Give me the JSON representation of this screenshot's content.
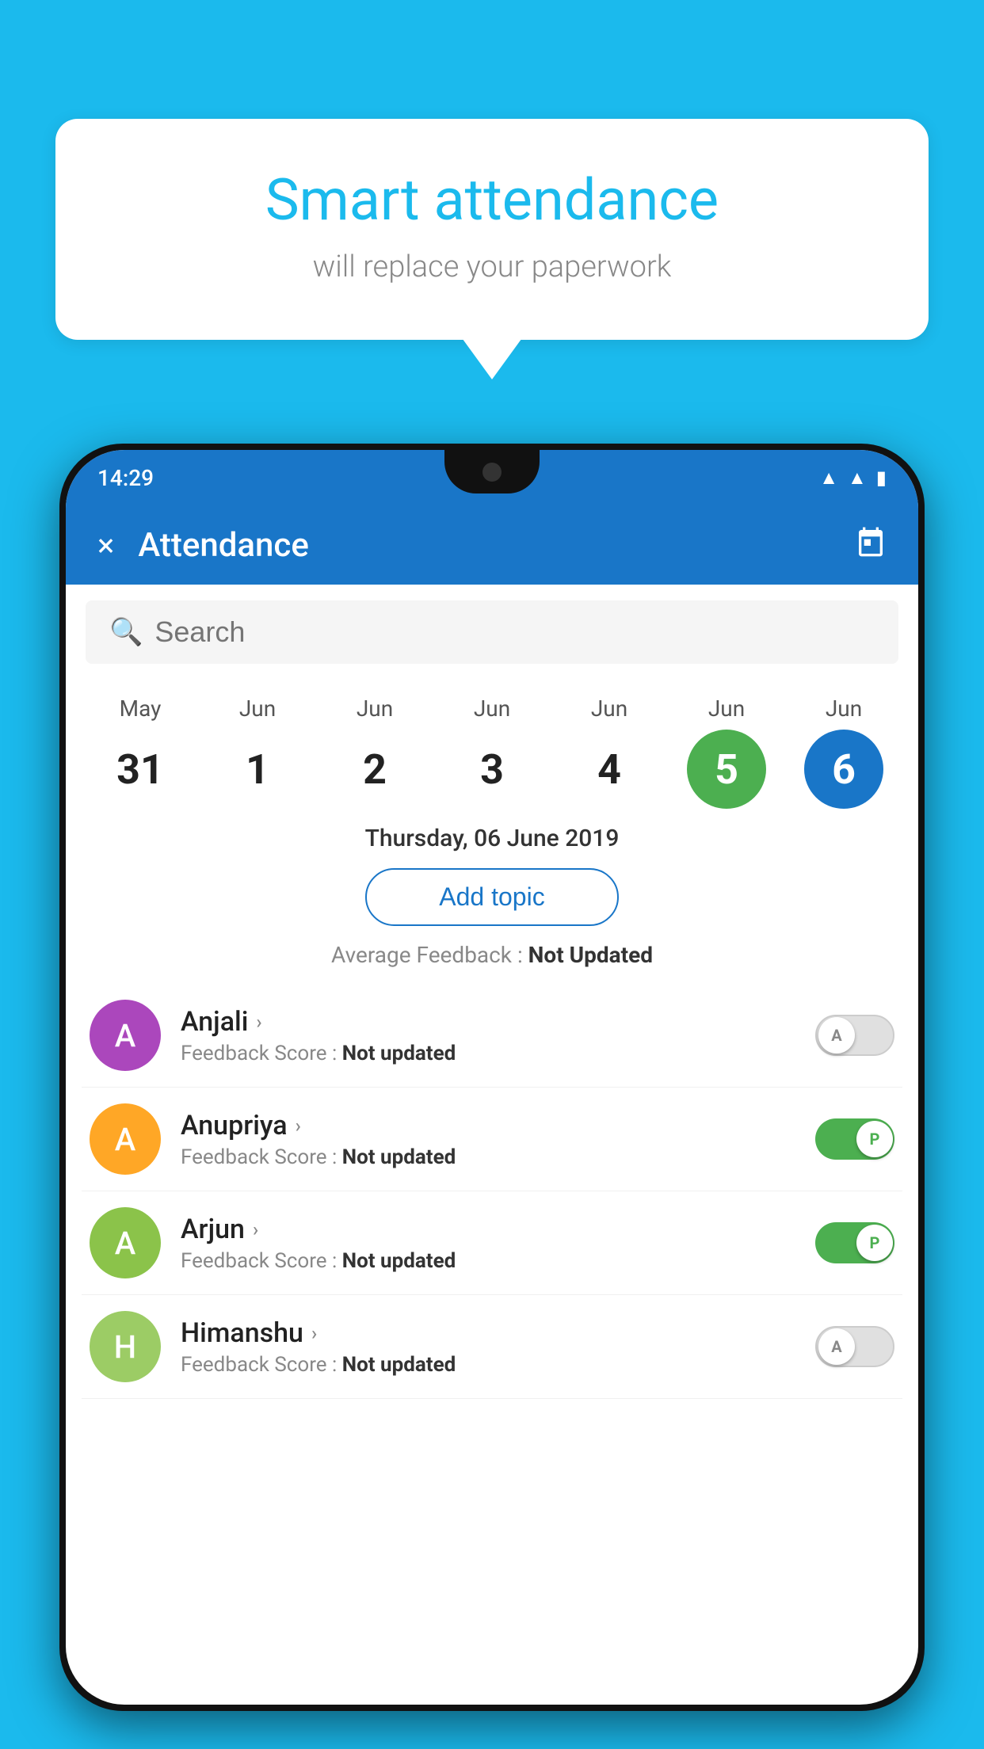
{
  "background_color": "#1BBAED",
  "speech_bubble": {
    "title": "Smart attendance",
    "subtitle": "will replace your paperwork"
  },
  "status_bar": {
    "time": "14:29",
    "icons": [
      "wifi",
      "signal",
      "battery"
    ]
  },
  "header": {
    "title": "Attendance",
    "close_label": "×",
    "calendar_label": "📅"
  },
  "search": {
    "placeholder": "Search"
  },
  "date_strip": {
    "dates": [
      {
        "month": "May",
        "day": "31",
        "state": "normal"
      },
      {
        "month": "Jun",
        "day": "1",
        "state": "normal"
      },
      {
        "month": "Jun",
        "day": "2",
        "state": "normal"
      },
      {
        "month": "Jun",
        "day": "3",
        "state": "normal"
      },
      {
        "month": "Jun",
        "day": "4",
        "state": "normal"
      },
      {
        "month": "Jun",
        "day": "5",
        "state": "today"
      },
      {
        "month": "Jun",
        "day": "6",
        "state": "selected"
      }
    ]
  },
  "selected_date_label": "Thursday, 06 June 2019",
  "add_topic_label": "Add topic",
  "average_feedback": {
    "label": "Average Feedback : ",
    "value": "Not Updated"
  },
  "students": [
    {
      "name": "Anjali",
      "avatar_letter": "A",
      "avatar_color": "#AB47BC",
      "feedback_label": "Feedback Score : ",
      "feedback_value": "Not updated",
      "toggle_state": "off",
      "toggle_letter": "A"
    },
    {
      "name": "Anupriya",
      "avatar_letter": "A",
      "avatar_color": "#FFA726",
      "feedback_label": "Feedback Score : ",
      "feedback_value": "Not updated",
      "toggle_state": "on",
      "toggle_letter": "P"
    },
    {
      "name": "Arjun",
      "avatar_letter": "A",
      "avatar_color": "#8BC34A",
      "feedback_label": "Feedback Score : ",
      "feedback_value": "Not updated",
      "toggle_state": "on",
      "toggle_letter": "P"
    },
    {
      "name": "Himanshu",
      "avatar_letter": "H",
      "avatar_color": "#9CCC65",
      "feedback_label": "Feedback Score : ",
      "feedback_value": "Not updated",
      "toggle_state": "off",
      "toggle_letter": "A"
    }
  ]
}
